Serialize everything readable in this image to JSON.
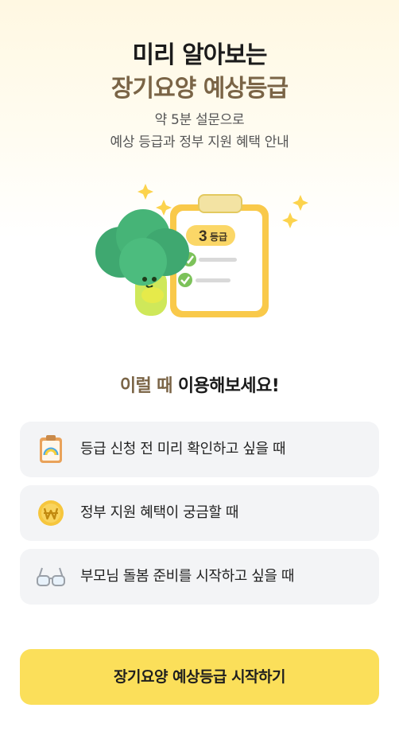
{
  "header": {
    "title_line1": "미리 알아보는",
    "title_line2": "장기요양 예상등급",
    "subtitle_line1": "약 5분 설문으로",
    "subtitle_line2": "예상 등급과 정부 지원 혜택 안내"
  },
  "hero": {
    "badge_number": "3",
    "badge_suffix": "등급",
    "icons": [
      "broccoli-character",
      "clipboard-icon",
      "sparkle-icon",
      "check-icon"
    ]
  },
  "section": {
    "title_accent": "이럴 때",
    "title_rest": " 이용해보세요!"
  },
  "cards": [
    {
      "label": "등급 신청 전 미리 확인하고 싶을 때",
      "icon": "clipboard-chart-icon"
    },
    {
      "label": "정부 지원 혜택이 궁금할 때",
      "icon": "won-coin-icon"
    },
    {
      "label": "부모님 돌봄 준비를 시작하고 싶을 때",
      "icon": "glasses-icon"
    }
  ],
  "cta": {
    "label": "장기요양 예상등급 시작하기"
  },
  "colors": {
    "accent_brown": "#7a6446",
    "cta_yellow": "#fbdf5a",
    "card_bg": "#f3f4f6",
    "check_green": "#7cc25a"
  }
}
